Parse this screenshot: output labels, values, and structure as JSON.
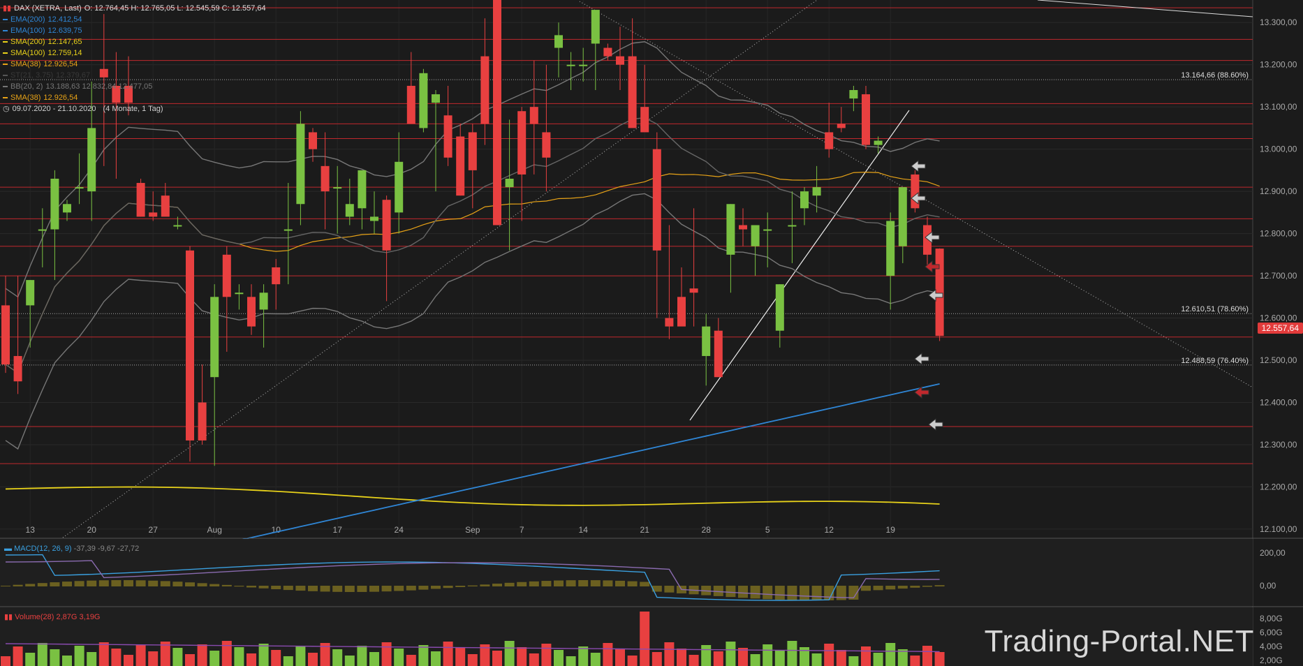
{
  "header": {
    "symbol_line": "DAX (XETRA, Last)",
    "ohlc": "O: 12.764,45  H: 12.765,05  L: 12.545,59  C: 12.557,64",
    "period": "09.07.2020 - 21.10.2020",
    "range": "(4 Monate, 1 Tag)"
  },
  "indicators": [
    {
      "label": "EMA(200)",
      "value": "12.412,54",
      "color": "#2f86d6"
    },
    {
      "label": "EMA(100)",
      "value": "12.639,75",
      "color": "#2f86d6"
    },
    {
      "label": "SMA(200)",
      "value": "12.147,65",
      "color": "#e8d21a"
    },
    {
      "label": "SMA(100)",
      "value": "12.759,14",
      "color": "#e8d21a"
    },
    {
      "label": "SMA(38)",
      "value": "12.926,54",
      "color": "#e8a317"
    },
    {
      "label": "ST(21, 3.75)",
      "value": "12.379,67",
      "color": "#555555"
    },
    {
      "label": "BB(20, 2)",
      "value": "13.188,63  12.832,84  12.477,05",
      "color": "#777777"
    },
    {
      "label": "SMA(38)",
      "value": "12.926,54",
      "color": "#e8a317"
    }
  ],
  "macd": {
    "label": "MACD(12, 26, 9)",
    "values": "-37,39  -9,67  -27,72"
  },
  "volume": {
    "label": "Volume(28)",
    "values": "2,87G  3,19G"
  },
  "watermark": "Trading-Portal.NET",
  "last_price": "12.557,64",
  "fib_labels": [
    {
      "text": "13.164,66 (88.60%)",
      "price": 13164.66
    },
    {
      "text": "12.610,51 (78.60%)",
      "price": 12610.51
    },
    {
      "text": "12.488,59 (76.40%)",
      "price": 12488.59
    }
  ],
  "colors": {
    "up": "#7ac142",
    "down": "#e84040",
    "hline": "#c0282d",
    "bg": "#1b1b1b"
  },
  "chart_data": {
    "type": "candlestick",
    "price_axis": {
      "min": 12080,
      "max": 13350,
      "ticks": [
        12100,
        12200,
        12300,
        12400,
        12500,
        12600,
        12700,
        12800,
        12900,
        13000,
        13100,
        13200,
        13300
      ],
      "tick_labels": [
        "12.100,00",
        "12.200,00",
        "12.300,00",
        "12.400,00",
        "12.500,00",
        "12.600,00",
        "12.700,00",
        "12.800,00",
        "12.900,00",
        "13.000,00",
        "13.100,00",
        "13.200,00",
        "13.300,00"
      ]
    },
    "x_labels": [
      {
        "i": 2,
        "t": "13"
      },
      {
        "i": 7,
        "t": "20"
      },
      {
        "i": 12,
        "t": "27"
      },
      {
        "i": 17,
        "t": "Aug"
      },
      {
        "i": 22,
        "t": "10"
      },
      {
        "i": 27,
        "t": "17"
      },
      {
        "i": 32,
        "t": "24"
      },
      {
        "i": 38,
        "t": "Sep"
      },
      {
        "i": 42,
        "t": "7"
      },
      {
        "i": 47,
        "t": "14"
      },
      {
        "i": 52,
        "t": "21"
      },
      {
        "i": 57,
        "t": "28"
      },
      {
        "i": 62,
        "t": "5"
      },
      {
        "i": 67,
        "t": "12"
      },
      {
        "i": 72,
        "t": "19"
      }
    ],
    "horizontal_levels": [
      13335,
      13260,
      13210,
      13108,
      13060,
      13025,
      12910,
      12835,
      12770,
      12700,
      12555,
      12343,
      12255
    ],
    "candles": [
      [
        12630,
        12700,
        12470,
        12490
      ],
      [
        12510,
        12700,
        12420,
        12450
      ],
      [
        12630,
        12690,
        12530,
        12690
      ],
      [
        12810,
        12860,
        12720,
        12810
      ],
      [
        12810,
        12950,
        12690,
        12930
      ],
      [
        12850,
        12880,
        12830,
        12870
      ],
      [
        12910,
        12990,
        12870,
        12910
      ],
      [
        12900,
        13160,
        12830,
        13050
      ],
      [
        13190,
        13320,
        12960,
        13170
      ],
      [
        13150,
        13230,
        12930,
        13110
      ],
      [
        13150,
        13220,
        13080,
        13110
      ],
      [
        12920,
        12930,
        12840,
        12840
      ],
      [
        12850,
        12900,
        12830,
        12840
      ],
      [
        12890,
        12920,
        12850,
        12840
      ],
      [
        12820,
        12840,
        12810,
        12820
      ],
      [
        12760,
        12770,
        12260,
        12310
      ],
      [
        12400,
        12490,
        12300,
        12310
      ],
      [
        12460,
        12680,
        12250,
        12650
      ],
      [
        12750,
        12770,
        12520,
        12650
      ],
      [
        12660,
        12680,
        12620,
        12660
      ],
      [
        12650,
        12680,
        12560,
        12580
      ],
      [
        12620,
        12680,
        12530,
        12660
      ],
      [
        12720,
        12740,
        12620,
        12680
      ],
      [
        12810,
        12920,
        12680,
        12810
      ],
      [
        12870,
        13090,
        12820,
        13060
      ],
      [
        13040,
        13050,
        12970,
        13000
      ],
      [
        12960,
        13040,
        12810,
        12900
      ],
      [
        12910,
        12960,
        12800,
        12910
      ],
      [
        12840,
        12930,
        12820,
        12870
      ],
      [
        12860,
        12950,
        12810,
        12950
      ],
      [
        12830,
        12900,
        12800,
        12840
      ],
      [
        12880,
        12890,
        12640,
        12760
      ],
      [
        12850,
        13040,
        12800,
        12970
      ],
      [
        13150,
        13230,
        13060,
        13060
      ],
      [
        13050,
        13190,
        13040,
        13180
      ],
      [
        13110,
        13140,
        12900,
        13130
      ],
      [
        13080,
        13150,
        12960,
        12980
      ],
      [
        13030,
        13060,
        12890,
        12890
      ],
      [
        13040,
        13060,
        12860,
        12950
      ],
      [
        13220,
        13310,
        13010,
        13060
      ],
      [
        13380,
        13410,
        12820,
        12820
      ],
      [
        12910,
        13070,
        12760,
        12930
      ],
      [
        13090,
        13100,
        12830,
        12940
      ],
      [
        13100,
        13210,
        12940,
        13060
      ],
      [
        13040,
        13200,
        12900,
        12980
      ],
      [
        13240,
        13300,
        13170,
        13270
      ],
      [
        13200,
        13230,
        13140,
        13200
      ],
      [
        13200,
        13240,
        13160,
        13200
      ],
      [
        13250,
        13300,
        13140,
        13330
      ],
      [
        13240,
        13250,
        13210,
        13220
      ],
      [
        13220,
        13290,
        13140,
        13200
      ],
      [
        13220,
        13310,
        13090,
        13050
      ],
      [
        13100,
        13200,
        13080,
        13040
      ],
      [
        13000,
        13040,
        12600,
        12760
      ],
      [
        12600,
        12820,
        12550,
        12580
      ],
      [
        12650,
        12720,
        12600,
        12580
      ],
      [
        12670,
        12860,
        12580,
        12660
      ],
      [
        12510,
        12610,
        12440,
        12580
      ],
      [
        12570,
        12600,
        12460,
        12460
      ],
      [
        12750,
        12870,
        12660,
        12870
      ],
      [
        12820,
        12860,
        12770,
        12810
      ],
      [
        12770,
        12820,
        12700,
        12820
      ],
      [
        12810,
        12850,
        12720,
        12810
      ],
      [
        12570,
        12680,
        12530,
        12680
      ],
      [
        12820,
        12900,
        12730,
        12820
      ],
      [
        12860,
        12910,
        12820,
        12900
      ],
      [
        12890,
        12960,
        12850,
        12910
      ],
      [
        13040,
        13110,
        12980,
        13000
      ],
      [
        13060,
        13100,
        13040,
        13050
      ],
      [
        13120,
        13150,
        13090,
        13140
      ],
      [
        13130,
        13150,
        13000,
        13010
      ],
      [
        13010,
        13030,
        12990,
        13020
      ],
      [
        12700,
        12850,
        12620,
        12830
      ],
      [
        12770,
        12890,
        12730,
        12910
      ],
      [
        12940,
        12950,
        12850,
        12860
      ],
      [
        12820,
        12840,
        12720,
        12750
      ],
      [
        12764.45,
        12765.05,
        12545.59,
        12557.64
      ]
    ],
    "series": [
      {
        "name": "SMA(200)",
        "color": "#e8d21a",
        "values": "sma200"
      },
      {
        "name": "EMA(200)",
        "color": "#2f86d6",
        "values": "ema200"
      },
      {
        "name": "EMA(100)",
        "color": "#2f86d6",
        "values": "ema100"
      },
      {
        "name": "SMA(38)",
        "color": "#e8a317",
        "values": "sma38"
      }
    ],
    "macd_axis": {
      "ticks": [
        200,
        0
      ],
      "tick_labels": [
        "200,00",
        "0,00"
      ]
    },
    "volume_axis": {
      "tick_labels": [
        "8,00G",
        "6,00G",
        "4,00G",
        "2,00G"
      ]
    }
  }
}
